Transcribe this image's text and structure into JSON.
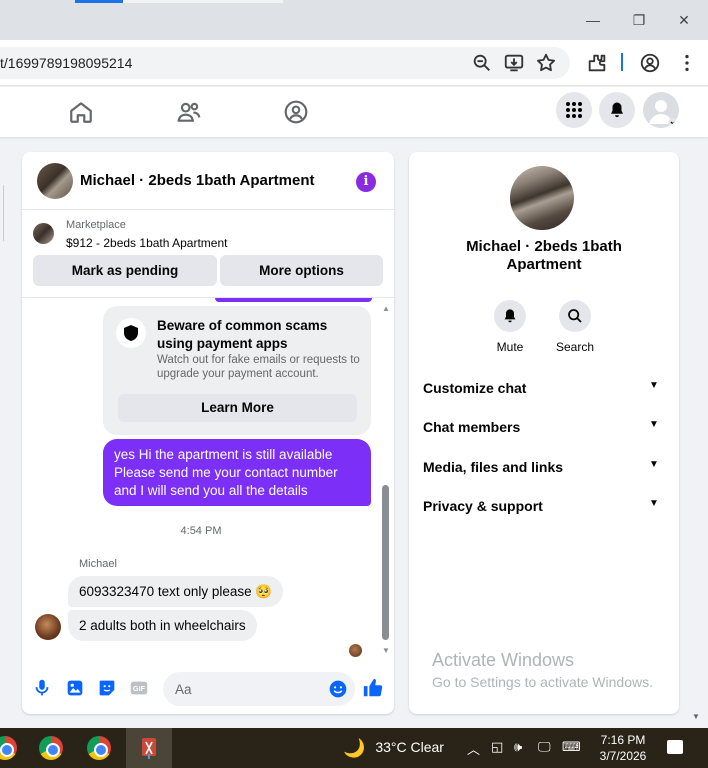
{
  "browser": {
    "url": "t/1699789198095214",
    "window_controls": {
      "minimize": "—",
      "restore": "❐",
      "close": "✕"
    }
  },
  "chat": {
    "title": "Michael · 2beds 1bath Apartment",
    "info_icon": "i",
    "listing": {
      "source": "Marketplace",
      "title": "$912 - 2beds 1bath Apartment",
      "mark_pending_label": "Mark as pending",
      "more_options_label": "More options"
    },
    "scam_notice": {
      "title": "Beware of common scams using payment apps",
      "body": "Watch out for fake emails or requests to upgrade your payment account.",
      "button_label": "Learn More"
    },
    "messages": {
      "sent_1": "yes Hi the apartment is still available Please send me your contact number and I will send you all the details",
      "timestamp": "4:54 PM",
      "sender_name": "Michael",
      "received_1": "6093323470 text only please 🥺",
      "received_2": "2 adults both in wheelchairs"
    },
    "composer": {
      "placeholder": "Aa"
    }
  },
  "side_panel": {
    "title": "Michael · 2beds 1bath Apartment",
    "actions": [
      {
        "label": "Mute",
        "icon": "bell-icon"
      },
      {
        "label": "Search",
        "icon": "search-icon"
      }
    ],
    "sections": [
      {
        "label": "Customize chat"
      },
      {
        "label": "Chat members"
      },
      {
        "label": "Media, files and links"
      },
      {
        "label": "Privacy & support"
      }
    ],
    "watermark": {
      "title": "Activate Windows",
      "subtitle": "Go to Settings to activate Windows."
    }
  },
  "taskbar": {
    "weather": "33°C  Clear",
    "time": "7:16 PM",
    "date": "3/7/2026"
  },
  "colors": {
    "accent": "#7b2ff7",
    "fb_blue": "#0866ff",
    "bubble_grey": "#eeeff1"
  }
}
